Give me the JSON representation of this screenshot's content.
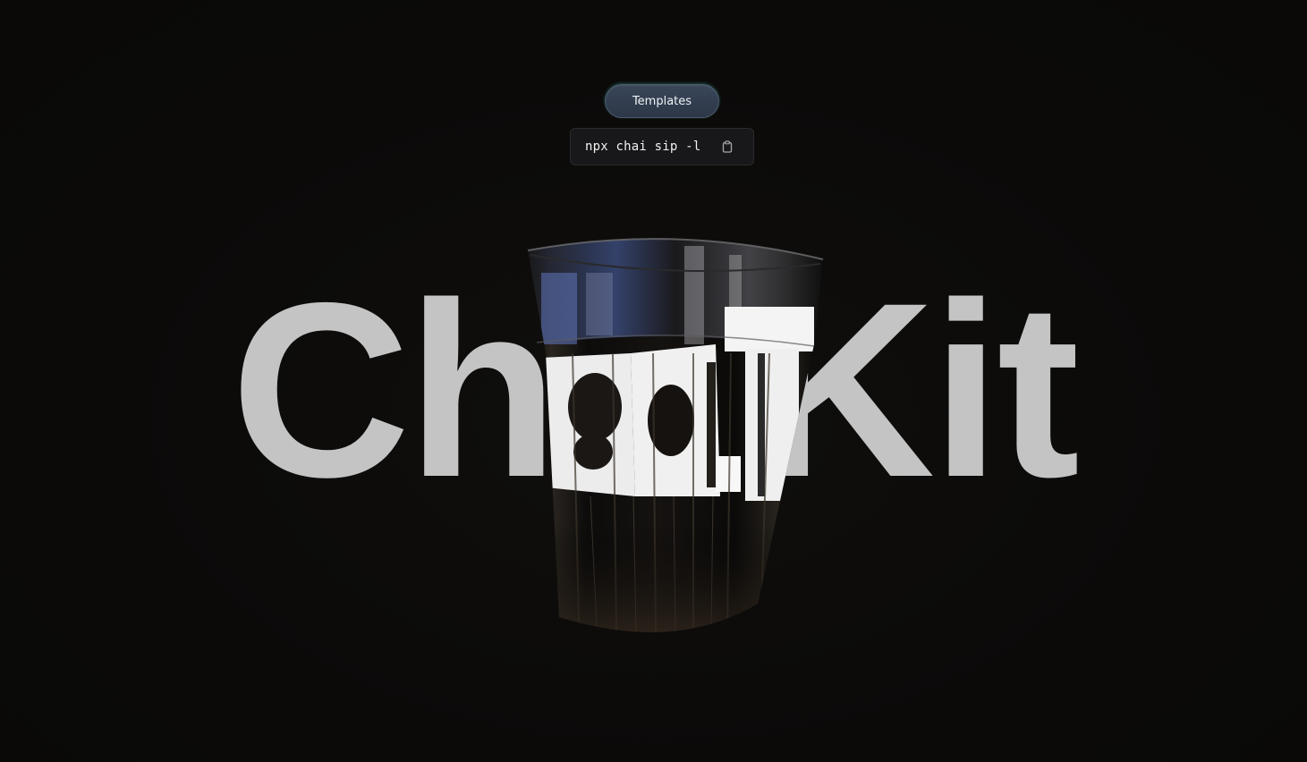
{
  "header": {
    "templates_label": "Templates"
  },
  "command": {
    "text": "npx chai sip -l",
    "copy_icon": "clipboard-icon"
  },
  "hero": {
    "title": "ChaiKit",
    "cup_icon": "glass-cup-3d"
  },
  "colors": {
    "background": "#0b0a09",
    "title": "#c4c4c4",
    "button": "#334052",
    "command_bg": "#18181a"
  }
}
